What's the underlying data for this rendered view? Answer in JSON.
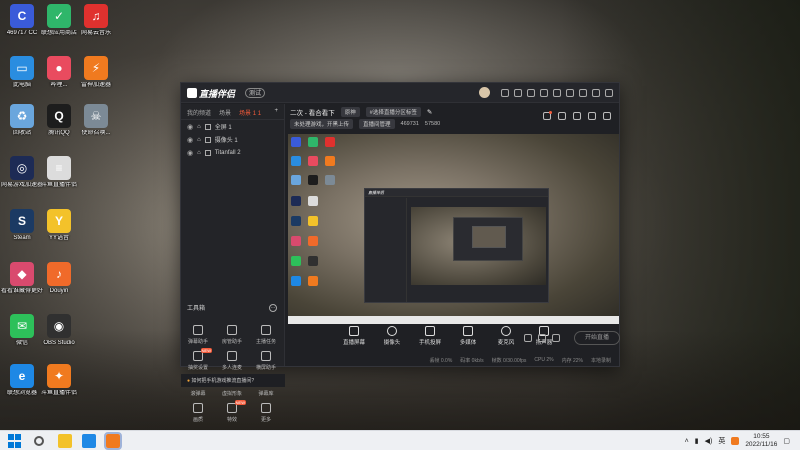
{
  "desktop": {
    "icons": [
      {
        "label": "469717 CC",
        "color": "#3a5bd9",
        "glyph": "C"
      },
      {
        "label": "联想应用商店",
        "color": "#2fb66a",
        "glyph": "✓"
      },
      {
        "label": "网易云音乐",
        "color": "#e0312e",
        "glyph": "♫"
      },
      {
        "label": "此电脑",
        "color": "#2a8de0",
        "glyph": "▭"
      },
      {
        "label": "哔哩...",
        "color": "#e94b5f",
        "glyph": "●"
      },
      {
        "label": "雷神加速器",
        "color": "#f07a1f",
        "glyph": "⚡"
      },
      {
        "label": "回收站",
        "color": "#6aa6dd",
        "glyph": "♻"
      },
      {
        "label": "腾讯QQ",
        "color": "#1d1d1d",
        "glyph": "Q"
      },
      {
        "label": "使命召唤...",
        "color": "#7c8a96",
        "glyph": "☠"
      },
      {
        "label": "网易游戏加速器",
        "color": "#1d2b55",
        "glyph": "◎"
      },
      {
        "label": "斗鱼直播伴侣",
        "color": "#dcdcdc",
        "glyph": "≡"
      },
      {
        "label": "Steam",
        "color": "#1b3a63",
        "glyph": "S"
      },
      {
        "label": "YY语音",
        "color": "#f3c22a",
        "glyph": "Y"
      },
      {
        "label": "看看谁藏得更好",
        "color": "#d94a6e",
        "glyph": "◆"
      },
      {
        "label": "Douyin",
        "color": "#f06a2a",
        "glyph": "♪"
      },
      {
        "label": "微信",
        "color": "#2dc05a",
        "glyph": "✉"
      },
      {
        "label": "OBS Studio",
        "color": "#303030",
        "glyph": "◉"
      },
      {
        "label": "联想浏览器",
        "color": "#1e88e5",
        "glyph": "e"
      },
      {
        "label": "斗鱼直播伴侣",
        "color": "#f07a1f",
        "glyph": "✦"
      }
    ]
  },
  "app": {
    "brand": "直播伴侣",
    "version_badge": "测试",
    "left_tabs": [
      "我的频道",
      "场景",
      "场景 1"
    ],
    "tab_badge": "1",
    "scenes": [
      "全屏 1",
      "摄像头 1",
      "Titanfall 2"
    ],
    "tools_header": "工具箱",
    "tools": [
      {
        "label": "弹幕助手",
        "tag": ""
      },
      {
        "label": "房管助手",
        "tag": ""
      },
      {
        "label": "主播任务",
        "tag": ""
      },
      {
        "label": "抽奖设置",
        "tag": "NEW"
      },
      {
        "label": "多人连麦",
        "tag": ""
      },
      {
        "label": "横屏助手",
        "tag": ""
      },
      {
        "label": "滚弹幕",
        "tag": ""
      },
      {
        "label": "虚拟形象",
        "tag": ""
      },
      {
        "label": "弹幕库",
        "tag": ""
      },
      {
        "label": "画质",
        "tag": ""
      },
      {
        "label": "特效",
        "tag": "NEW"
      },
      {
        "label": "更多",
        "tag": ""
      }
    ],
    "hint": "如何把手机游戏推流直播间?",
    "live_title": "二次 - 看合看下",
    "category": "原神",
    "room_tag": "#选择直播分区标签",
    "row2": [
      "未处理游戏，开黑上传",
      "直播间管理",
      "469731",
      "57580"
    ],
    "controls": [
      {
        "label": "直播屏幕",
        "round": false
      },
      {
        "label": "摄像头",
        "round": true
      },
      {
        "label": "手机投屏",
        "round": false
      },
      {
        "label": "多媒体",
        "round": false
      },
      {
        "label": "麦克风",
        "round": true
      },
      {
        "label": "扬声器",
        "round": false
      }
    ],
    "start_button": "开始直播",
    "status": [
      "丢帧 0.0%",
      "码率 0kb/s",
      "帧数 0/30.00fps",
      "CPU 2%",
      "内存 22%",
      "本地录制"
    ]
  },
  "taskbar": {
    "time": "10:55",
    "date": "2022/11/16",
    "tray_text": "英",
    "apps": [
      {
        "name": "search-icon",
        "color": "#555"
      },
      {
        "name": "file-explorer-icon",
        "color": "#f3c22a"
      },
      {
        "name": "edge-icon",
        "color": "#1e88e5"
      },
      {
        "name": "streamer-app-icon",
        "color": "#f07a1f"
      }
    ]
  }
}
